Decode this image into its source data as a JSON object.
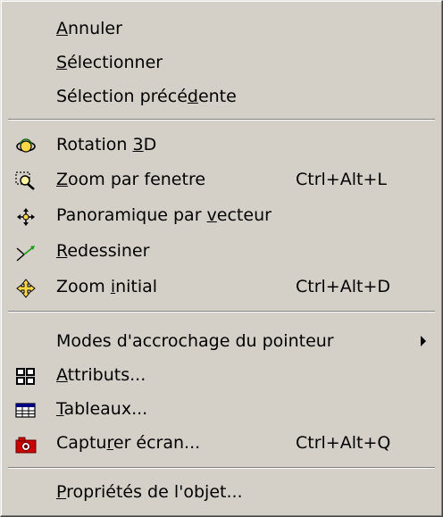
{
  "menu": {
    "items": [
      {
        "pre": "",
        "key": "A",
        "post": "nnuler",
        "shortcut": ""
      },
      {
        "pre": "",
        "key": "S",
        "post": "électionner",
        "shortcut": ""
      },
      {
        "pre": "Sélection précé",
        "key": "d",
        "post": "ente",
        "shortcut": ""
      },
      {
        "pre": "Rotation ",
        "key": "3",
        "post": "D",
        "shortcut": ""
      },
      {
        "pre": "",
        "key": "Z",
        "post": "oom par fenetre",
        "shortcut": "Ctrl+Alt+L"
      },
      {
        "pre": "Panoramique par ",
        "key": "v",
        "post": "ecteur",
        "shortcut": ""
      },
      {
        "pre": "",
        "key": "R",
        "post": "edessiner",
        "shortcut": ""
      },
      {
        "pre": "Zoom ",
        "key": "i",
        "post": "nitial",
        "shortcut": "Ctrl+Alt+D"
      },
      {
        "pre": "Modes d'accrochage du pointeur",
        "key": "",
        "post": "",
        "shortcut": ""
      },
      {
        "pre": "",
        "key": "A",
        "post": "ttributs...",
        "shortcut": ""
      },
      {
        "pre": "",
        "key": "T",
        "post": "ableaux...",
        "shortcut": ""
      },
      {
        "pre": "Captu",
        "key": "r",
        "post": "er écran...",
        "shortcut": "Ctrl+Alt+Q"
      },
      {
        "pre": "",
        "key": "P",
        "post": "ropriétés de l'objet...",
        "shortcut": ""
      }
    ]
  },
  "icons": {
    "rotation_3d": "orbit-icon",
    "zoom_window": "zoom-window-icon",
    "pan_vector": "pan-arrows-icon",
    "redraw": "redraw-icon",
    "zoom_initial": "zoom-extents-icon",
    "submenu": "submenu-arrow-icon",
    "attributes": "attributes-grid-icon",
    "tables": "table-icon",
    "capture": "camera-icon"
  },
  "colors": {
    "menu_bg": "#d4d0c8",
    "text": "#000000",
    "capture_icon": "#cc0000",
    "table_icon": "#000080"
  }
}
